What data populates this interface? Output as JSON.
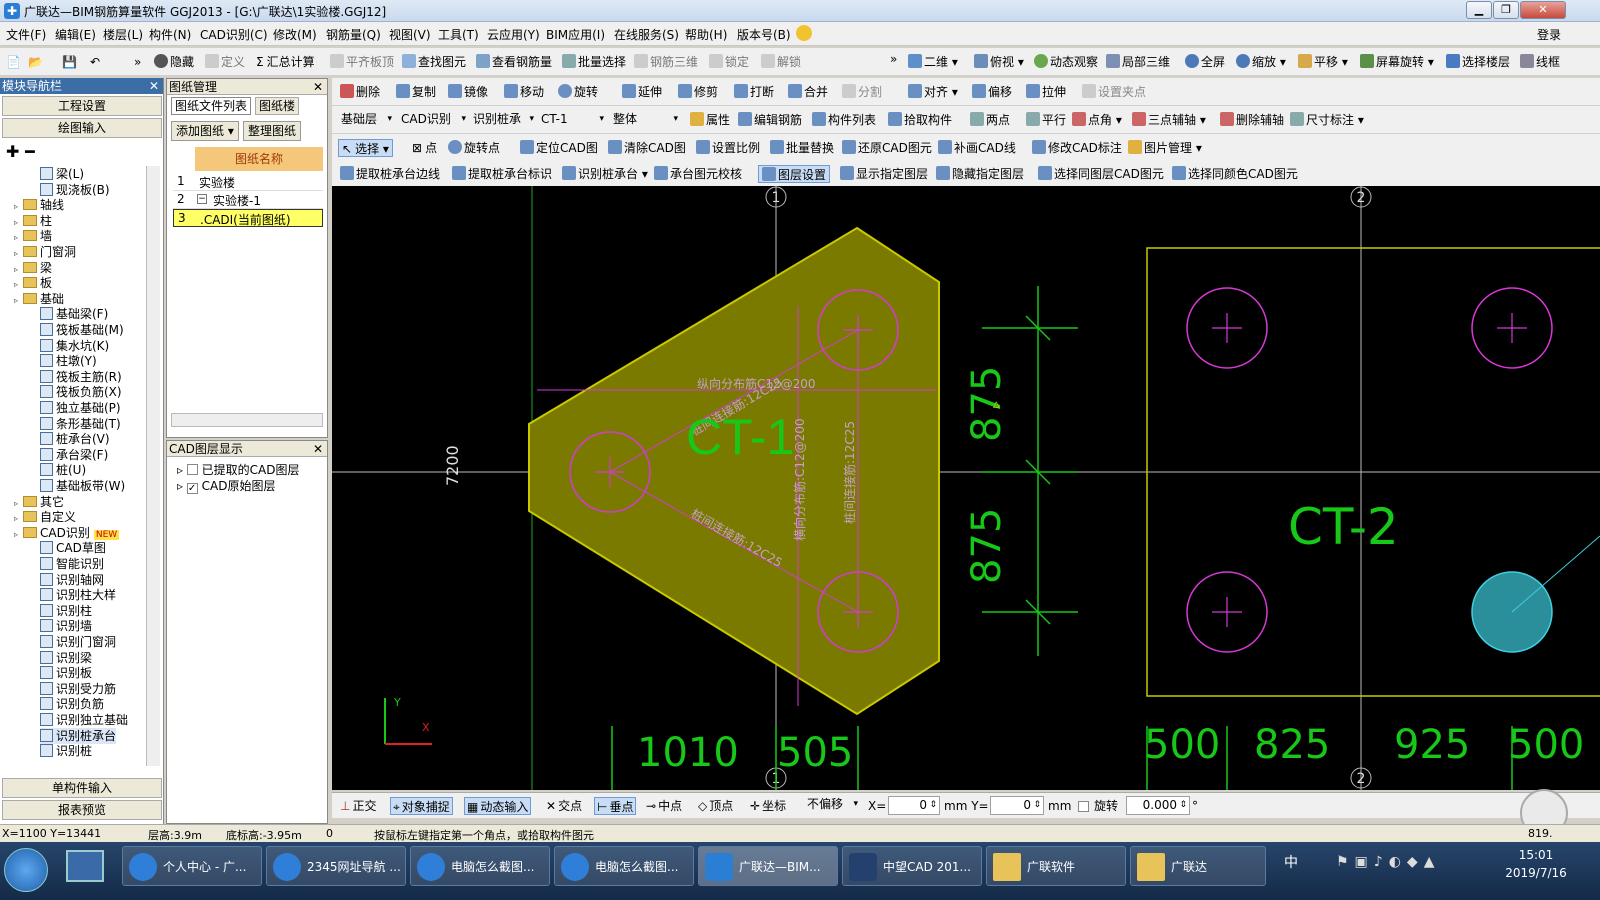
{
  "window": {
    "title": "广联达—BIM钢筋算量软件 GGJ2013 - [G:\\广联达\\1实验楼.GGJ12]",
    "login": "登录"
  },
  "menu": [
    "文件(F)",
    "编辑(E)",
    "楼层(L)",
    "构件(N)",
    "CAD识别(C)",
    "修改(M)",
    "钢筋量(Q)",
    "视图(V)",
    "工具(T)",
    "云应用(Y)",
    "BIM应用(I)",
    "在线服务(S)",
    "帮助(H)",
    "版本号(B)"
  ],
  "toolbar1": [
    "隐藏",
    "定义",
    "汇总计算",
    "平齐板顶",
    "查找图元",
    "查看钢筋量",
    "批量选择",
    "钢筋三维",
    "锁定",
    "解锁",
    "二维",
    "俯视",
    "动态观察",
    "局部三维",
    "全屏",
    "缩放",
    "平移",
    "屏幕旋转",
    "选择楼层",
    "线框"
  ],
  "toolbar2": [
    "删除",
    "复制",
    "镜像",
    "移动",
    "旋转",
    "延伸",
    "修剪",
    "打断",
    "合并",
    "分割",
    "对齐",
    "偏移",
    "拉伸",
    "设置夹点"
  ],
  "toolbar3": {
    "floor": "基础层",
    "mode": "CAD识别",
    "sub": "识别桩承",
    "component": "CT-1",
    "scope": "整体",
    "items": [
      "属性",
      "编辑钢筋",
      "构件列表",
      "拾取构件",
      "两点",
      "平行",
      "点角",
      "三点辅轴",
      "删除辅轴",
      "尺寸标注"
    ]
  },
  "toolbar4": [
    "选择",
    "点",
    "旋转点",
    "定位CAD图",
    "清除CAD图",
    "设置比例",
    "批量替换",
    "还原CAD图元",
    "补画CAD线",
    "修改CAD标注",
    "图片管理"
  ],
  "toolbar5": [
    "提取桩承台边线",
    "提取桩承台标识",
    "识别桩承台",
    "承台图元校核",
    "图层设置",
    "显示指定图层",
    "隐藏指定图层",
    "选择同图层CAD图元",
    "选择同颜色CAD图元"
  ],
  "nav": {
    "title": "模块导航栏",
    "btn_project": "工程设置",
    "btn_draw": "绘图输入",
    "tree": [
      {
        "label": "梁(L)",
        "level": 3
      },
      {
        "label": "现浇板(B)",
        "level": 3
      },
      {
        "label": "轴线",
        "level": 1
      },
      {
        "label": "柱",
        "level": 1
      },
      {
        "label": "墙",
        "level": 1
      },
      {
        "label": "门窗洞",
        "level": 1
      },
      {
        "label": "梁",
        "level": 1
      },
      {
        "label": "板",
        "level": 1
      },
      {
        "label": "基础",
        "level": 1
      },
      {
        "label": "基础梁(F)",
        "level": 2
      },
      {
        "label": "筏板基础(M)",
        "level": 2
      },
      {
        "label": "集水坑(K)",
        "level": 2
      },
      {
        "label": "柱墩(Y)",
        "level": 2
      },
      {
        "label": "筏板主筋(R)",
        "level": 2
      },
      {
        "label": "筏板负筋(X)",
        "level": 2
      },
      {
        "label": "独立基础(P)",
        "level": 2
      },
      {
        "label": "条形基础(T)",
        "level": 2
      },
      {
        "label": "桩承台(V)",
        "level": 2
      },
      {
        "label": "承台梁(F)",
        "level": 2
      },
      {
        "label": "桩(U)",
        "level": 2
      },
      {
        "label": "基础板带(W)",
        "level": 2
      },
      {
        "label": "其它",
        "level": 1
      },
      {
        "label": "自定义",
        "level": 1
      },
      {
        "label": "CAD识别",
        "level": 1
      },
      {
        "label": "CAD草图",
        "level": 2
      },
      {
        "label": "智能识别",
        "level": 2
      },
      {
        "label": "识别轴网",
        "level": 2
      },
      {
        "label": "识别柱大样",
        "level": 2
      },
      {
        "label": "识别柱",
        "level": 2
      },
      {
        "label": "识别墙",
        "level": 2
      },
      {
        "label": "识别门窗洞",
        "level": 2
      },
      {
        "label": "识别梁",
        "level": 2
      },
      {
        "label": "识别板",
        "level": 2
      },
      {
        "label": "识别受力筋",
        "level": 2
      },
      {
        "label": "识别负筋",
        "level": 2
      },
      {
        "label": "识别独立基础",
        "level": 2
      },
      {
        "label": "识别桩承台",
        "level": 2
      },
      {
        "label": "识别桩",
        "level": 2
      }
    ],
    "new_badge": "NEW",
    "btn_single": "单构件输入",
    "btn_report": "报表预览"
  },
  "drawing_manager": {
    "title": "图纸管理",
    "tabs": [
      "图纸文件列表",
      "图纸楼"
    ],
    "btn_add": "添加图纸",
    "btn_sort": "整理图纸",
    "col": "图纸名称",
    "rows": [
      {
        "no": "1",
        "name": "实验楼"
      },
      {
        "no": "2",
        "name": "实验楼-1"
      },
      {
        "no": "3",
        "name": ".CADI(当前图纸)"
      }
    ]
  },
  "cad_layers": {
    "title": "CAD图层显示",
    "items": [
      "已提取的CAD图层",
      "CAD原始图层"
    ]
  },
  "canvas": {
    "axis_top": [
      "1",
      "2"
    ],
    "ct1": "CT-1",
    "ct2": "CT-2",
    "dim_7200": "7200",
    "dim_875a": "875",
    "dim_875b": "875",
    "bottom_dims": [
      "1010",
      "505",
      "500",
      "825",
      "925",
      "500"
    ],
    "rebar_labels": [
      "纵向分布筋C12@200",
      "桩间连接筋:12C25",
      "横向分布筋:C12@200",
      "桩间连接筋:12C25",
      "桩间连接筋:12C25"
    ],
    "axis_y": "Y",
    "axis_x": "X"
  },
  "snapbar": {
    "items": [
      "正交",
      "对象捕捉",
      "动态输入",
      "交点",
      "垂点",
      "中点",
      "顶点",
      "坐标",
      "不偏移"
    ],
    "x_label": "X=",
    "x_val": "0",
    "y_label": "mm Y=",
    "y_val": "0",
    "mm": "mm",
    "rotate": "旋转",
    "rotate_val": "0.000",
    "deg": "°"
  },
  "status": {
    "coords": "X=1100 Y=13441",
    "floor_h": "层高:3.9m",
    "base_h": "底标高:-3.95m",
    "num": "0",
    "hint": "按鼠标左键指定第一个角点，或拾取构件图元",
    "right": "819."
  },
  "taskbar": {
    "items": [
      "个人中心 - 广...",
      "2345网址导航 ...",
      "电脑怎么截图...",
      "电脑怎么截图...",
      "广联达—BIM...",
      "中望CAD 201...",
      "广联软件",
      "广联达"
    ],
    "time": "15:01",
    "date": "2019/7/16",
    "ime": "中"
  }
}
